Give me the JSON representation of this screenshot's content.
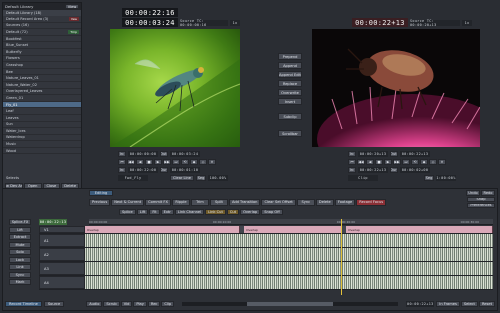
{
  "library": {
    "title": "Default Library",
    "title_action": "View",
    "subtitle": "Default Library (18)",
    "items": [
      {
        "label": "Default Record Area (3)",
        "tag": "Vew",
        "tag_color": "red",
        "selected": false
      },
      {
        "label": "Sources (16)",
        "tag": "",
        "tag_color": "",
        "selected": false
      },
      {
        "label": "Default (72)",
        "tag": "Tmp",
        "tag_color": "green",
        "selected": false
      },
      {
        "label": "Bookfest",
        "tag": "",
        "selected": false
      },
      {
        "label": "Blue_Sunset",
        "tag": "",
        "selected": false
      },
      {
        "label": "Butterfly",
        "tag": "",
        "selected": false
      },
      {
        "label": "Flowers",
        "tag": "",
        "selected": false
      },
      {
        "label": "Grasshop",
        "tag": "",
        "selected": false
      },
      {
        "label": "Bee",
        "tag": "",
        "selected": false
      },
      {
        "label": "Nature_Leaves_01",
        "tag": "",
        "selected": false
      },
      {
        "label": "Nature_Water_02",
        "tag": "",
        "selected": false
      },
      {
        "label": "Overlayered_Leaves",
        "tag": "",
        "selected": false
      },
      {
        "label": "Green_01",
        "tag": "",
        "selected": false
      },
      {
        "label": "Fly_01",
        "tag": "",
        "selected": true
      },
      {
        "label": "Leaf",
        "tag": "",
        "selected": false
      },
      {
        "label": "Leaves",
        "tag": "",
        "selected": false
      },
      {
        "label": "Sun",
        "tag": "",
        "selected": false
      },
      {
        "label": "Water_Ices",
        "tag": "",
        "selected": false
      },
      {
        "label": "Waterdrop",
        "tag": "",
        "selected": false
      },
      {
        "label": "Music",
        "tag": "",
        "selected": false
      },
      {
        "label": "Wood",
        "tag": "",
        "selected": false
      }
    ],
    "footer_label": "Selects",
    "footer_buttons": [
      "New Dev Area",
      "Open",
      "Close",
      "Delete"
    ]
  },
  "source": {
    "timecode_top": "00:00:22:16",
    "timecode_main": "00:00:03:24",
    "tc_label": "Source TC: 00:00:00:16",
    "tc_extra": "1x",
    "transport_row1": [
      "In:",
      "00:00:00:00",
      "Out:",
      "00:00:03:24"
    ],
    "transport_row2": [
      "In:",
      "00:00:22:00",
      "Dur:",
      "00:00:01:10"
    ],
    "clip_name": "Fwd_Fly",
    "clear_label": "Clear Line",
    "seg_label": "Seg",
    "seg_value": "100.00%"
  },
  "record": {
    "timecode_main": "00:00:22+13",
    "tc_label": "Source TC: 00:00:20+13",
    "tc_extra": "1x",
    "transport_row1": [
      "In:",
      "00:00:20+13",
      "Out:",
      "00:00:22+13"
    ],
    "transport_row2": [
      "In:",
      "00:00:22+13",
      "Dur:",
      "00:00:02+00"
    ],
    "clip_name": "Clip",
    "seg_label": "Seg",
    "seg_value": "1:00:00%"
  },
  "middle_tools": {
    "buttons": [
      "Prepend",
      "Append",
      "Append Edit",
      "Replace",
      "Overwrite",
      "Insert"
    ],
    "lower_buttons": [
      "Subclip",
      "Scrollbar"
    ]
  },
  "editing": {
    "tab_label": "Editing",
    "right_tabs": [
      "Undo",
      "Redo"
    ],
    "top_buttons": [
      "Previous",
      "Next & Current",
      "Commit FX",
      "Ripple",
      "Trim",
      "Split",
      "Add Transition",
      "Clear Set Offset",
      "Sync",
      "Delete",
      "Footage",
      "Record Focus"
    ],
    "right_side": [
      "Snap",
      "Preferences"
    ],
    "second_row": [
      "Splice",
      "Lift",
      "Fit",
      "Extr",
      "Link Channel",
      "Link Cut",
      "Cut",
      "Overlap",
      "Snap Off"
    ],
    "left_rail": [
      "Splice-FX",
      "Lift",
      "Extract",
      "Mute",
      "Solo",
      "Lock",
      "Link",
      "Sync",
      "Mark"
    ],
    "timecode": "00:00:22:13",
    "tracks": [
      {
        "name": "V1",
        "clips": [
          "Overlap",
          "Overlap",
          "Overlap"
        ]
      },
      {
        "name": "A1",
        "clips": []
      },
      {
        "name": "A2",
        "clips": []
      },
      {
        "name": "A3",
        "clips": []
      },
      {
        "name": "A4",
        "clips": []
      }
    ],
    "ruler_marks": [
      "00:00:00:00",
      "00:00:10:00",
      "00:00:20:00",
      "00:00:30:00"
    ],
    "footer_left": [
      "Record Timeline",
      "Source"
    ],
    "footer_mid": [
      "Audio",
      "Scrub",
      "Vid",
      "Play",
      "Rec",
      "Clip"
    ],
    "footer_right_tc": "00:00:22+13",
    "footer_right": [
      "In Frames",
      "Select",
      "Reset"
    ]
  },
  "colors": {
    "accent_red": "#8b2f35",
    "accent_green": "#3c6a3b",
    "selection": "#4e6a88",
    "playhead": "#e4c23a",
    "clip_pink": "#d9a8b8"
  }
}
